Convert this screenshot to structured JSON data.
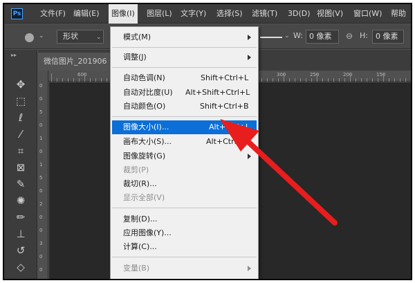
{
  "app": {
    "logo": "Ps"
  },
  "menubar": {
    "items": [
      "文件(F)",
      "编辑(E)",
      "图像(I)",
      "图层(L)",
      "文字(Y)",
      "选择(S)",
      "滤镜(T)",
      "3D(D)",
      "视图(V)",
      "窗口(W)",
      "帮助"
    ]
  },
  "options": {
    "shape_mode": "形状",
    "w_label": "W:",
    "w_value": "0 像素",
    "h_label": "H:",
    "h_value": "0 像素"
  },
  "document": {
    "tab_title": "微信图片_201906",
    "ruler_h": [
      "600",
      "300",
      "250",
      "200",
      "150"
    ],
    "ruler_v": [
      "0",
      "0",
      "5",
      "0",
      "1",
      "0",
      "1",
      "5",
      "0",
      "2",
      "0",
      "0",
      "3",
      "0",
      "0"
    ]
  },
  "menu": {
    "items": [
      {
        "label": "模式(M)",
        "shortcut": "",
        "submenu": true,
        "disabled": false,
        "highlighted": false
      },
      {
        "label": "调整(J)",
        "shortcut": "",
        "submenu": true,
        "disabled": false,
        "highlighted": false
      },
      {
        "label": "自动色调(N)",
        "shortcut": "Shift+Ctrl+L",
        "submenu": false,
        "disabled": false,
        "highlighted": false
      },
      {
        "label": "自动对比度(U)",
        "shortcut": "Alt+Shift+Ctrl+L",
        "submenu": false,
        "disabled": false,
        "highlighted": false
      },
      {
        "label": "自动颜色(O)",
        "shortcut": "Shift+Ctrl+B",
        "submenu": false,
        "disabled": false,
        "highlighted": false
      },
      {
        "label": "图像大小(I)...",
        "shortcut": "Alt+Ctrl+I",
        "submenu": false,
        "disabled": false,
        "highlighted": true
      },
      {
        "label": "画布大小(S)...",
        "shortcut": "Alt+Ctrl+C",
        "submenu": false,
        "disabled": false,
        "highlighted": false
      },
      {
        "label": "图像旋转(G)",
        "shortcut": "",
        "submenu": true,
        "disabled": false,
        "highlighted": false
      },
      {
        "label": "裁剪(P)",
        "shortcut": "",
        "submenu": false,
        "disabled": true,
        "highlighted": false
      },
      {
        "label": "裁切(R)...",
        "shortcut": "",
        "submenu": false,
        "disabled": false,
        "highlighted": false
      },
      {
        "label": "显示全部(V)",
        "shortcut": "",
        "submenu": false,
        "disabled": true,
        "highlighted": false
      },
      {
        "label": "复制(D)...",
        "shortcut": "",
        "submenu": false,
        "disabled": false,
        "highlighted": false
      },
      {
        "label": "应用图像(Y)...",
        "shortcut": "",
        "submenu": false,
        "disabled": false,
        "highlighted": false
      },
      {
        "label": "计算(C)...",
        "shortcut": "",
        "submenu": false,
        "disabled": false,
        "highlighted": false
      },
      {
        "label": "变量(B)",
        "shortcut": "",
        "submenu": true,
        "disabled": true,
        "highlighted": false
      }
    ]
  },
  "colors": {
    "highlight": "#0b6fd7",
    "annotation_arrow": "#e81d1d"
  },
  "icons": {
    "tools": [
      "move-icon",
      "marquee-icon",
      "lasso-icon",
      "quick-select-icon",
      "crop-icon",
      "frame-icon",
      "eyedropper-icon",
      "spot-heal-icon",
      "brush-icon",
      "stamp-icon",
      "history-brush-icon",
      "eraser-icon"
    ]
  }
}
